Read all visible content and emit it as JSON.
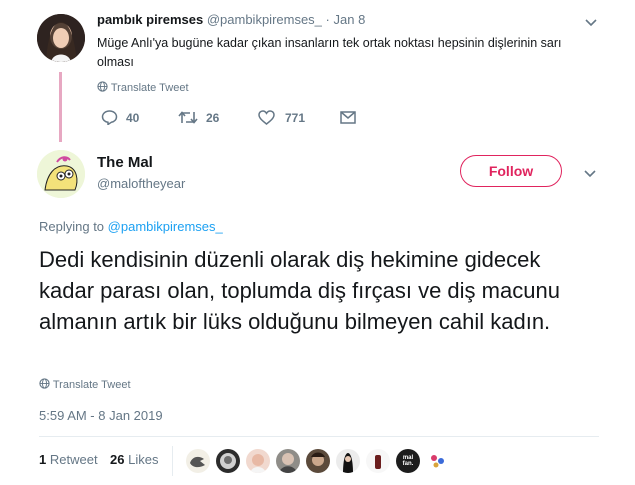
{
  "reply_tweet": {
    "display_name": "pambık piremses",
    "handle": "@pambikpiremses_",
    "separator": "·",
    "date": "Jan 8",
    "text": "Müge Anlı'ya bugüne kadar çıkan insanların tek ortak noktası hepsinin dişlerinin sarı olması",
    "translate_label": "Translate Tweet",
    "reply_count": "40",
    "retweet_count": "26",
    "like_count": "771"
  },
  "main_tweet": {
    "display_name": "The Mal",
    "handle": "@maloftheyear",
    "follow_label": "Follow",
    "replying_prefix": "Replying to",
    "replying_handle": "@pambikpiremses_",
    "text": "Dedi kendisinin düzenli olarak diş hekimine gidecek kadar parası olan, toplumda diş fırçası ve diş macunu almanın artık bir lüks olduğunu bilmeyen cahil kadın.",
    "translate_label": "Translate Tweet",
    "timestamp": "5:59 AM - 8 Jan 2019",
    "retweets_count": "1",
    "retweets_label": "Retweet",
    "likes_count": "26",
    "likes_label": "Likes",
    "liker_badge_text": "mal fan."
  },
  "colors": {
    "link": "#1da1f2",
    "follow": "#e0245e",
    "thread_line": "#e7a8c2",
    "muted": "#657786"
  }
}
